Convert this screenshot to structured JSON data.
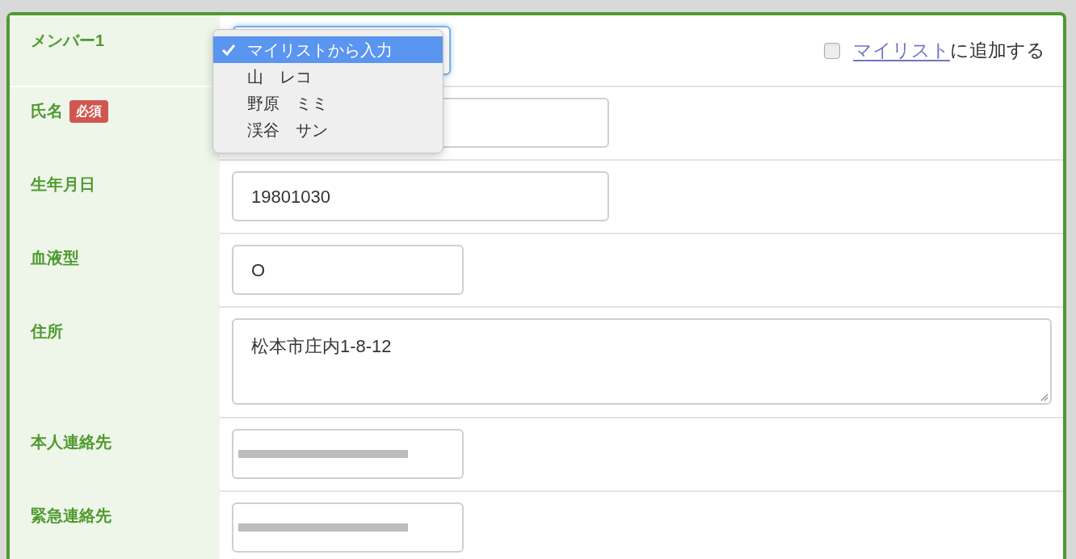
{
  "member": {
    "label": "メンバー1",
    "add_to_mylist": {
      "checked": false,
      "link": "マイリスト",
      "text": "に追加する"
    }
  },
  "select_menu": {
    "options": [
      {
        "label": "マイリストから入力",
        "selected": true
      },
      {
        "label": "山　レコ",
        "selected": false
      },
      {
        "label": "野原　ミミ",
        "selected": false
      },
      {
        "label": "渓谷　サン",
        "selected": false
      }
    ]
  },
  "fields": [
    {
      "label": "氏名",
      "badge": "必須",
      "kind": "medium"
    },
    {
      "label": "生年月日",
      "kind": "medium",
      "value": "19801030"
    },
    {
      "label": "血液型",
      "kind": "short",
      "value": "O"
    },
    {
      "label": "住所",
      "kind": "textarea",
      "value": "松本市庄内1-8-12"
    },
    {
      "label": "本人連絡先",
      "kind": "short",
      "redacted": true
    },
    {
      "label": "緊急連絡先",
      "kind": "short",
      "redacted": true
    }
  ]
}
